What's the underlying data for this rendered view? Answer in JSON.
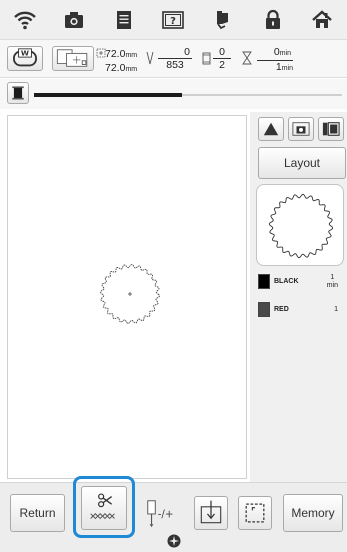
{
  "status_bar": {
    "icons": [
      "wifi-icon",
      "camera-icon",
      "document-icon",
      "help-icon",
      "thread-spool-icon",
      "lock-icon",
      "home-icon"
    ]
  },
  "info": {
    "width_value": "72.0",
    "height_value": "72.0",
    "size_unit": "mm",
    "stitch_current": "0",
    "stitch_total": "853",
    "color_current": "0",
    "color_total": "2",
    "time_current": "0",
    "time_total": "1",
    "time_unit": "min"
  },
  "progress": {
    "fraction": 0.48
  },
  "side_panel": {
    "layout_label": "Layout",
    "colors": [
      {
        "name": "BLACK",
        "time_value": "1",
        "time_unit": "min",
        "color": "#000000"
      },
      {
        "name": "RED",
        "time_value": "1",
        "time_unit": "",
        "color": "#4a4a4a"
      }
    ]
  },
  "toolbar": {
    "return_label": "Return",
    "memory_label": "Memory"
  },
  "colors": {
    "highlight": "#1e8ad6",
    "progress": "#1c1c1c"
  }
}
